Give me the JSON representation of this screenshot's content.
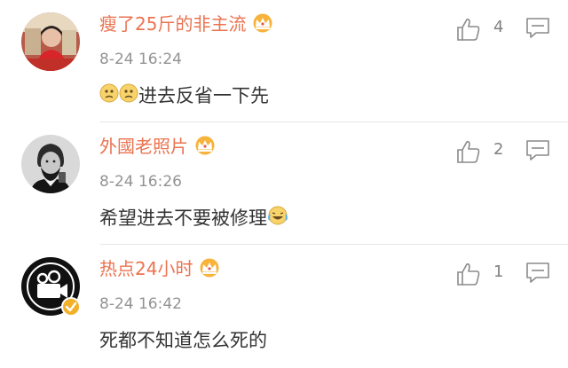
{
  "comments": [
    {
      "username": "瘦了25斤的非主流",
      "time": "8-24 16:24",
      "text": "进去反省一下先",
      "likes": "4",
      "avatar": "photo-avatar",
      "badge": "crown-icon",
      "emoji_position": "before",
      "emoji": "thinking-emoji-pair"
    },
    {
      "username": "外國老照片",
      "time": "8-24 16:26",
      "text": "希望进去不要被修理",
      "likes": "2",
      "avatar": "lincoln-avatar",
      "badge": "crown-icon",
      "emoji_position": "after",
      "emoji": "laughing-crying-emoji"
    },
    {
      "username": "热点24小时",
      "time": "8-24 16:42",
      "text": "死都不知道怎么死的",
      "likes": "1",
      "avatar": "video-camera-avatar",
      "badge": "crown-icon",
      "verified": "verified-badge"
    }
  ],
  "colors": {
    "username": "#eb7350",
    "time": "#939393",
    "text": "#333333",
    "icon": "#8a8a8a",
    "crown": "#f0a030"
  }
}
